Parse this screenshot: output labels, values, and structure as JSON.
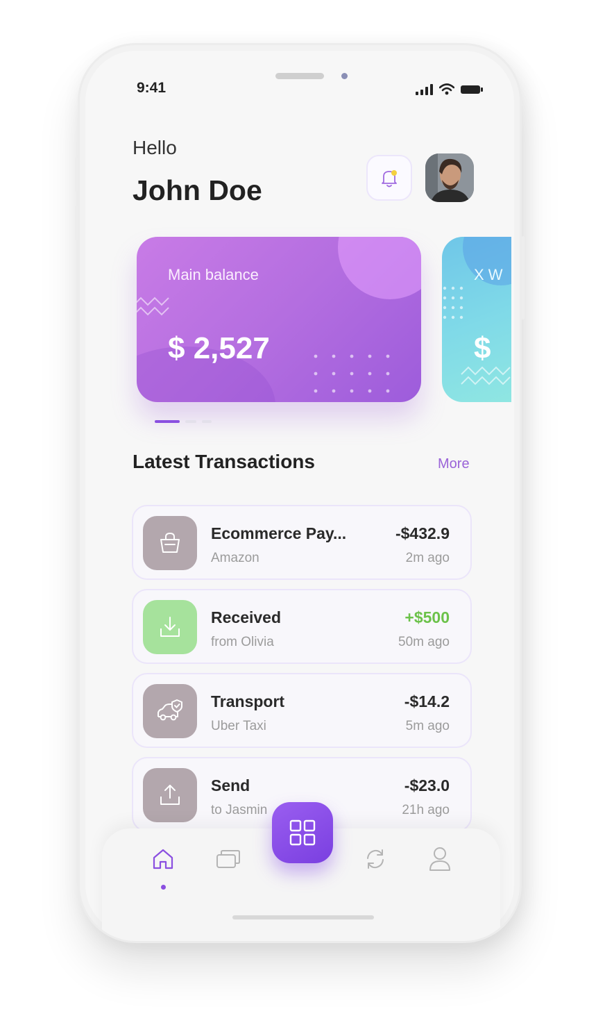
{
  "status_bar": {
    "time": "9:41"
  },
  "header": {
    "greeting": "Hello",
    "user_name": "John Doe"
  },
  "cards": [
    {
      "label": "Main balance",
      "amount": "$ 2,527",
      "colors": [
        "#c87be6",
        "#9d5cdb"
      ]
    },
    {
      "label": "X W",
      "amount": "$",
      "colors": [
        "#6fc6e8",
        "#8fe6e2"
      ]
    }
  ],
  "transactions_section": {
    "title": "Latest Transactions",
    "more_label": "More"
  },
  "transactions": [
    {
      "title": "Ecommerce Pay...",
      "subtitle": "Amazon",
      "amount": "-$432.9",
      "time": "2m ago",
      "icon": "shopping-bag-icon",
      "icon_bg": "#b3a7ad",
      "amount_color": "#2a2a2a"
    },
    {
      "title": "Received",
      "subtitle": "from Olivia",
      "amount": "+$500",
      "time": "50m ago",
      "icon": "download-icon",
      "icon_bg": "#a6e29c",
      "amount_color": "#6cc24a"
    },
    {
      "title": "Transport",
      "subtitle": "Uber Taxi",
      "amount": "-$14.2",
      "time": "5m ago",
      "icon": "car-icon",
      "icon_bg": "#b3a7ad",
      "amount_color": "#2a2a2a"
    },
    {
      "title": "Send",
      "subtitle": "to Jasmin",
      "amount": "-$23.0",
      "time": "21h ago",
      "icon": "upload-icon",
      "icon_bg": "#b3a7ad",
      "amount_color": "#2a2a2a"
    }
  ],
  "nav": {
    "items": [
      "home-icon",
      "cards-icon",
      "grid-icon",
      "refresh-icon",
      "profile-icon"
    ],
    "active": "home-icon",
    "accent": "#8a4fe0"
  }
}
